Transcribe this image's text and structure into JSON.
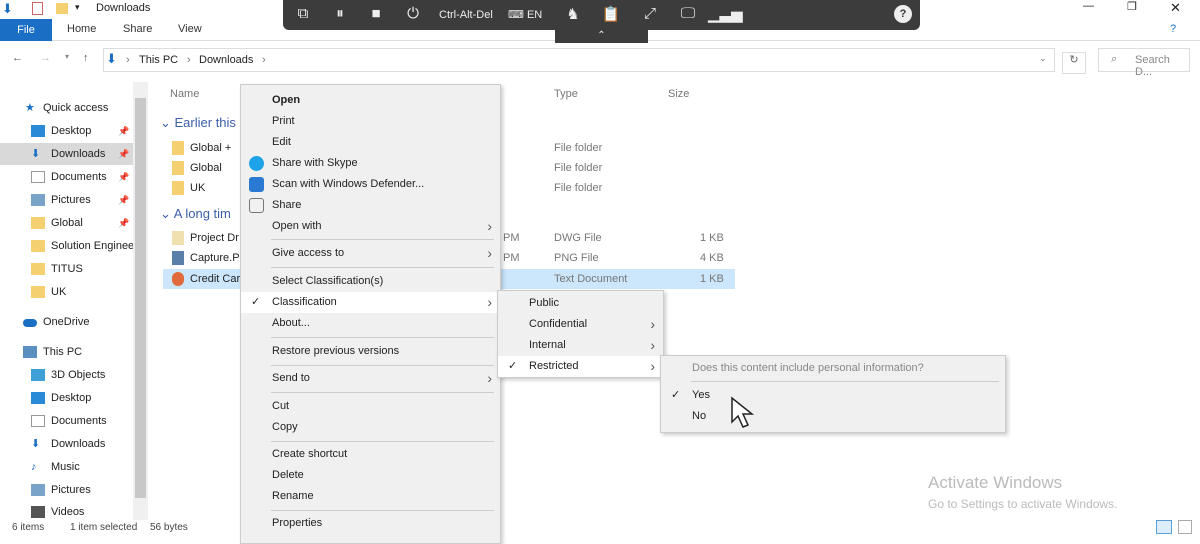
{
  "window": {
    "title": "Downloads",
    "minimize": "—",
    "maximize": "❐",
    "close": "✕"
  },
  "ribbon": {
    "tabs": [
      "File",
      "Home",
      "Share",
      "View"
    ]
  },
  "address": {
    "crumbs": [
      "This PC",
      "Downloads"
    ],
    "search_placeholder": "Search D..."
  },
  "remote_toolbar": {
    "ctrl_alt_del": "Ctrl-Alt-Del",
    "lang": "EN",
    "help": "?"
  },
  "nav": {
    "quick_access": "Quick access",
    "items": [
      "Desktop",
      "Downloads",
      "Documents",
      "Pictures",
      "Global",
      "Solution Enginee",
      "TITUS",
      "UK"
    ],
    "onedrive": "OneDrive",
    "this_pc": "This PC",
    "pc_items": [
      "3D Objects",
      "Desktop",
      "Documents",
      "Downloads",
      "Music",
      "Pictures",
      "Videos"
    ]
  },
  "columns": {
    "name": "Name",
    "type": "Type",
    "size": "Size"
  },
  "groups": [
    {
      "label": "Earlier this",
      "files": [
        {
          "name": "Global +",
          "date": "",
          "type": "File folder",
          "size": ""
        },
        {
          "name": "Global",
          "date": "",
          "type": "File folder",
          "size": ""
        },
        {
          "name": "UK",
          "date": "",
          "type": "File folder",
          "size": ""
        }
      ]
    },
    {
      "label": "A long tim",
      "files": [
        {
          "name": "Project Dr",
          "date": "PM",
          "type": "DWG File",
          "size": "1 KB"
        },
        {
          "name": "Capture.P",
          "date": "PM",
          "type": "PNG File",
          "size": "4 KB"
        },
        {
          "name": "Credit Car",
          "date": "",
          "type": "Text Document",
          "size": "1 KB"
        }
      ]
    }
  ],
  "context_menu": {
    "items": [
      "Open",
      "Print",
      "Edit",
      "Share with Skype",
      "Scan with Windows Defender...",
      "Share",
      "Open with",
      "Give access to",
      "Select Classification(s)",
      "Classification",
      "About...",
      "Restore previous versions",
      "Send to",
      "Cut",
      "Copy",
      "Create shortcut",
      "Delete",
      "Rename",
      "Properties"
    ]
  },
  "classification_menu": {
    "items": [
      "Public",
      "Confidential",
      "Internal",
      "Restricted"
    ]
  },
  "pii_menu": {
    "question": "Does this content include personal information?",
    "yes": "Yes",
    "no": "No"
  },
  "status": {
    "items": "6 items",
    "selected": "1 item selected",
    "size": "56 bytes"
  },
  "watermark": {
    "title": "Activate Windows",
    "subtitle": "Go to Settings to activate Windows."
  }
}
